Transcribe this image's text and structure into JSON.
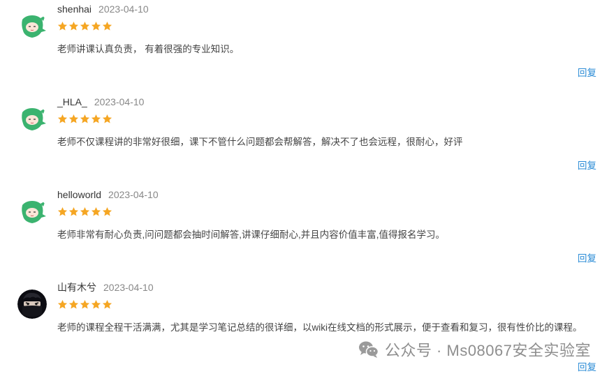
{
  "reviews": [
    {
      "avatar": "green-cactus-avatar",
      "username": "shenhai",
      "date": "2023-04-10",
      "rating": 5,
      "comment": "老师讲课认真负责， 有着很强的专业知识。",
      "reply_label": "回复"
    },
    {
      "avatar": "green-cactus-avatar",
      "username": "_HLA_",
      "date": "2023-04-10",
      "rating": 5,
      "comment": "老师不仅课程讲的非常好很细，课下不管什么问题都会帮解答，解决不了也会远程，很耐心，好评",
      "reply_label": "回复"
    },
    {
      "avatar": "green-cactus-avatar",
      "username": "helloworld",
      "date": "2023-04-10",
      "rating": 5,
      "comment": "老师非常有耐心负责,问问题都会抽时间解答,讲课仔细耐心,并且内容价值丰富,值得报名学习。",
      "reply_label": "回复"
    },
    {
      "avatar": "masked-person-avatar",
      "username": "山有木兮",
      "date": "2023-04-10",
      "rating": 5,
      "comment": "老师的课程全程干活满满，尤其是学习笔记总结的很详细，以wiki在线文档的形式展示，便于查看和复习，很有性价比的课程。",
      "reply_label": "回复"
    }
  ],
  "watermark": {
    "icon": "wechat-icon",
    "text": "公众号 · Ms08067安全实验室"
  },
  "colors": {
    "star": "#f5a623",
    "reply_link": "#2a8bd6",
    "avatar_green": "#3bb36f",
    "date": "#888888"
  }
}
